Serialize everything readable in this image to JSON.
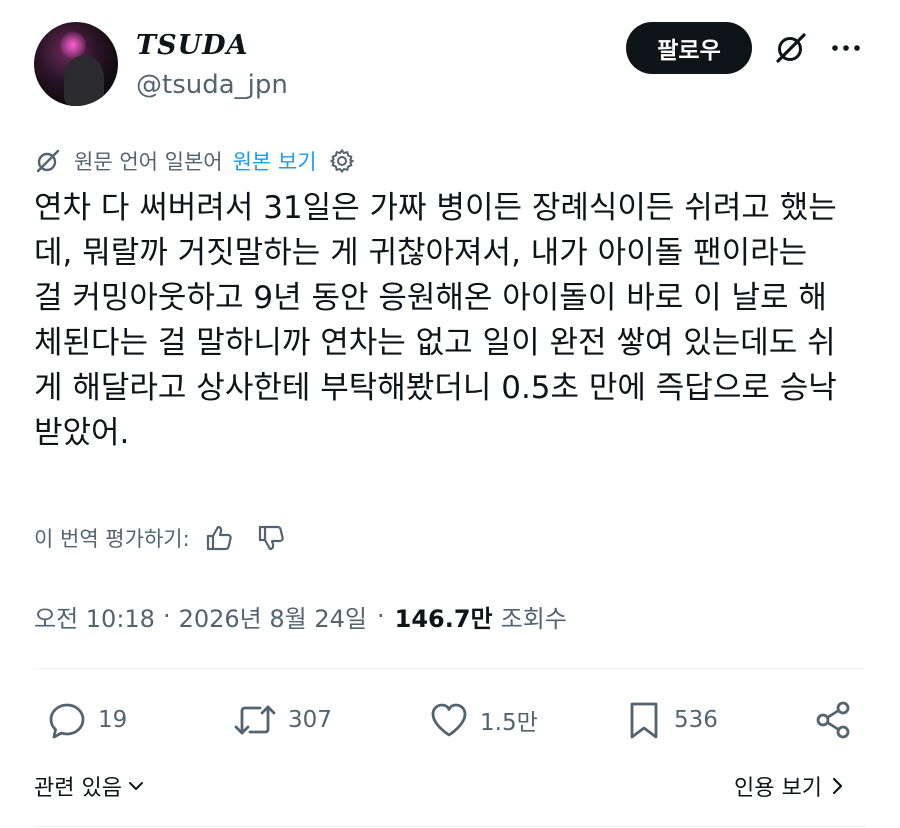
{
  "author": {
    "display_name": "TSUDA",
    "handle": "@tsuda_jpn"
  },
  "follow_button": "팔로우",
  "translation": {
    "original_language_label": "원문 언어 일본어",
    "view_original_link": "원본 보기",
    "rate_prompt": "이 번역 평가하기:"
  },
  "tweet": {
    "lines": [
      "연차 다 써버려서 31일은 가짜 병이든 장례식이든 쉬려고 했는",
      "데, 뭐랄까 거짓말하는 게 귀찮아져서, 내가 아이돌 팬이라는",
      "걸 커밍아웃하고 9년 동안 응원해온 아이돌이 바로 이 날로 해",
      "체된다는 걸 말하니까 연차는 없고 일이 완전 쌓여 있는데도 쉬",
      "게 해달라고 상사한테 부탁해봤더니 0.5초 만에 즉답으로 승낙",
      "받았어."
    ]
  },
  "meta": {
    "time": "오전 10:18",
    "date": "2026년 8월 24일",
    "views_count": "146.7만",
    "views_label": "조회수"
  },
  "actions": {
    "replies": "19",
    "reposts": "307",
    "likes": "1.5만",
    "bookmarks": "536"
  },
  "footer": {
    "related": "관련 있음",
    "quotes": "인용 보기"
  },
  "colors": {
    "link": "#1d9bf0",
    "text": "#0f1419",
    "secondary": "#536471"
  }
}
